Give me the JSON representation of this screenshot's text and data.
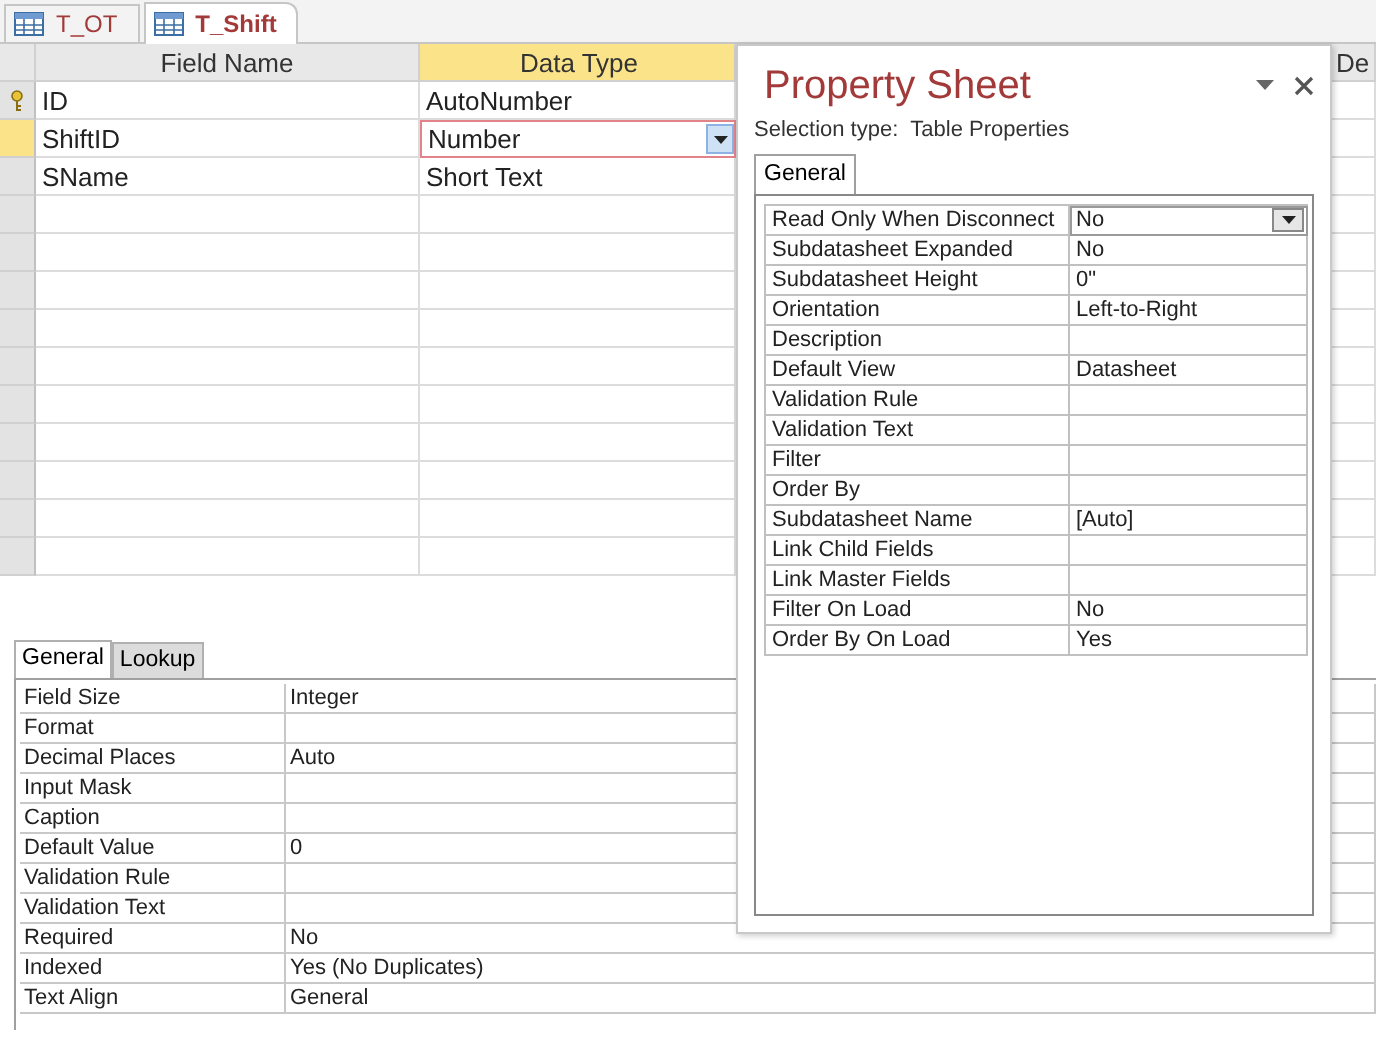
{
  "doc_tabs": [
    {
      "label": "T_OT",
      "selected": false
    },
    {
      "label": "T_Shift",
      "selected": true
    }
  ],
  "design_grid": {
    "columns": [
      "Field Name",
      "Data Type",
      "De"
    ],
    "rows": [
      {
        "field_name": "ID",
        "data_type": "AutoNumber",
        "primary_key": true,
        "selected": false
      },
      {
        "field_name": "ShiftID",
        "data_type": "Number",
        "primary_key": false,
        "selected": true
      },
      {
        "field_name": "SName",
        "data_type": "Short Text",
        "primary_key": false,
        "selected": false
      }
    ]
  },
  "field_properties": {
    "tabs": [
      {
        "label": "General",
        "selected": true
      },
      {
        "label": "Lookup",
        "selected": false
      }
    ],
    "rows": [
      {
        "label": "Field Size",
        "value": "Integer"
      },
      {
        "label": "Format"
      },
      {
        "label": "Decimal Places",
        "value": "Auto"
      },
      {
        "label": "Input Mask"
      },
      {
        "label": "Caption"
      },
      {
        "label": "Default Value",
        "value": "0"
      },
      {
        "label": "Validation Rule"
      },
      {
        "label": "Validation Text"
      },
      {
        "label": "Required",
        "value": "No"
      },
      {
        "label": "Indexed",
        "value": "Yes (No Duplicates)"
      },
      {
        "label": "Text Align",
        "value": "General"
      }
    ]
  },
  "property_sheet": {
    "title": "Property Sheet",
    "selection_type_label": "Selection type:",
    "selection_type": "Table Properties",
    "tabs": [
      {
        "label": "General",
        "selected": true
      }
    ],
    "rows": [
      {
        "label": "Read Only When Disconnect",
        "value": "No",
        "selected": true
      },
      {
        "label": "Subdatasheet Expanded",
        "value": "No",
        "selected": false
      },
      {
        "label": "Subdatasheet Height",
        "value": "0\"",
        "selected": false
      },
      {
        "label": "Orientation",
        "value": "Left-to-Right",
        "selected": false
      },
      {
        "label": "Description",
        "selected": false
      },
      {
        "label": "Default View",
        "value": "Datasheet",
        "selected": false
      },
      {
        "label": "Validation Rule",
        "selected": false
      },
      {
        "label": "Validation Text",
        "selected": false
      },
      {
        "label": "Filter",
        "selected": false
      },
      {
        "label": "Order By",
        "selected": false
      },
      {
        "label": "Subdatasheet Name",
        "value": "[Auto]",
        "selected": false
      },
      {
        "label": "Link Child Fields",
        "selected": false
      },
      {
        "label": "Link Master Fields",
        "selected": false
      },
      {
        "label": "Filter On Load",
        "value": "No",
        "selected": false
      },
      {
        "label": "Order By On Load",
        "value": "Yes",
        "selected": false
      }
    ]
  }
}
